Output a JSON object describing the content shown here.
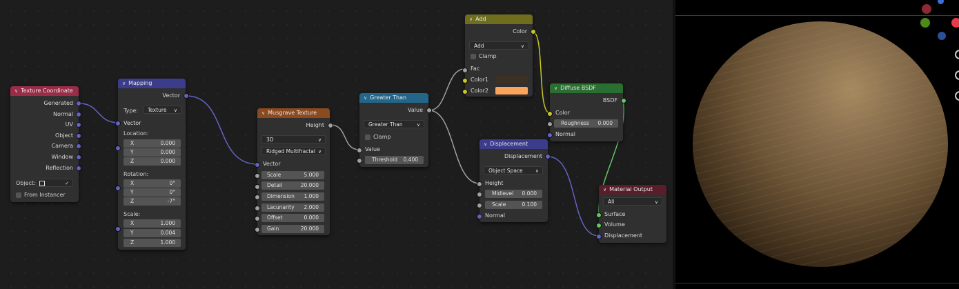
{
  "nodes": {
    "texcoord": {
      "title": "Texture Coordinate",
      "outputs": [
        "Generated",
        "Normal",
        "UV",
        "Object",
        "Camera",
        "Window",
        "Reflection"
      ],
      "object_label": "Object:",
      "from_instancer": "From Instancer"
    },
    "mapping": {
      "title": "Mapping",
      "output": "Vector",
      "type_label": "Type:",
      "type_value": "Texture",
      "vector_input": "Vector",
      "location_label": "Location:",
      "location": [
        {
          "axis": "X",
          "value": "0.000"
        },
        {
          "axis": "Y",
          "value": "0.000"
        },
        {
          "axis": "Z",
          "value": "0.000"
        }
      ],
      "rotation_label": "Rotation:",
      "rotation": [
        {
          "axis": "X",
          "value": "0°"
        },
        {
          "axis": "Y",
          "value": "0°"
        },
        {
          "axis": "Z",
          "value": "-7°"
        }
      ],
      "scale_label": "Scale:",
      "scale": [
        {
          "axis": "X",
          "value": "1.000"
        },
        {
          "axis": "Y",
          "value": "0.004"
        },
        {
          "axis": "Z",
          "value": "1.000"
        }
      ]
    },
    "musgrave": {
      "title": "Musgrave Texture",
      "output": "Height",
      "dimensions": "3D",
      "type": "Ridged Multifractal",
      "vector_input": "Vector",
      "fields": [
        {
          "label": "Scale",
          "value": "5.000"
        },
        {
          "label": "Detail",
          "value": "20.000"
        },
        {
          "label": "Dimension",
          "value": "1.000"
        },
        {
          "label": "Lacunarity",
          "value": "2.000"
        },
        {
          "label": "Offset",
          "value": "0.000"
        },
        {
          "label": "Gain",
          "value": "20.000"
        }
      ]
    },
    "greater": {
      "title": "Greater Than",
      "output": "Value",
      "operation": "Greater Than",
      "clamp": "Clamp",
      "value_input": "Value",
      "threshold_label": "Threshold",
      "threshold_value": "0.400"
    },
    "add": {
      "title": "Add",
      "output": "Color",
      "blend": "Add",
      "clamp": "Clamp",
      "fac": "Fac",
      "color1": "Color1",
      "color2": "Color2",
      "color1_hex": "#3d3126",
      "color2_hex": "#f9a35d"
    },
    "displacement": {
      "title": "Displacement",
      "output": "Displacement",
      "space": "Object Space",
      "height": "Height",
      "fields": [
        {
          "label": "Midlevel",
          "value": "0.000"
        },
        {
          "label": "Scale",
          "value": "0.100"
        }
      ],
      "normal": "Normal"
    },
    "diffuse": {
      "title": "Diffuse BSDF",
      "output": "BSDF",
      "color": "Color",
      "roughness_label": "Roughness",
      "roughness_value": "0.000",
      "normal": "Normal"
    },
    "output": {
      "title": "Material Output",
      "target": "All",
      "inputs": [
        "Surface",
        "Volume",
        "Displacement"
      ]
    }
  },
  "colors": {
    "texture_coord_header": "#9a2c47",
    "vector_header": "#3c3c8c",
    "texture_header": "#8c4a1f",
    "converter_header": "#23668a",
    "color_header": "#6e6e1e",
    "shader_header": "#2b6e31",
    "output_header": "#5a1e2a"
  },
  "viewport": {
    "sphere_base": "#7a6446",
    "gizmo": {
      "x_color": "#e33c4a",
      "y_color": "#63a81f",
      "z_color": "#3a6fd8"
    }
  }
}
